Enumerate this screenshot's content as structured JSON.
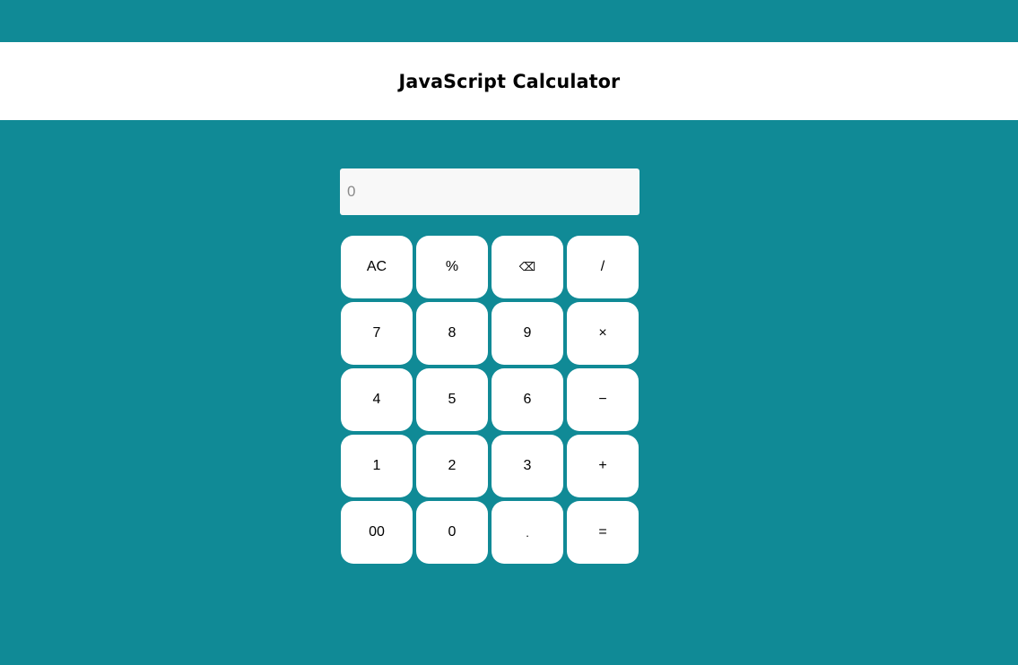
{
  "header": {
    "title": "JavaScript Calculator"
  },
  "display": {
    "value": "",
    "placeholder": "0"
  },
  "keys": [
    {
      "label": "AC"
    },
    {
      "label": "%"
    },
    {
      "label": "⌫"
    },
    {
      "label": "/"
    },
    {
      "label": "7"
    },
    {
      "label": "8"
    },
    {
      "label": "9"
    },
    {
      "label": "×"
    },
    {
      "label": "4"
    },
    {
      "label": "5"
    },
    {
      "label": "6"
    },
    {
      "label": "−"
    },
    {
      "label": "1"
    },
    {
      "label": "2"
    },
    {
      "label": "3"
    },
    {
      "label": "+"
    },
    {
      "label": "00"
    },
    {
      "label": "0"
    },
    {
      "label": "."
    },
    {
      "label": "="
    }
  ],
  "colors": {
    "background": "#108a96",
    "header": "#ffffff",
    "key": "#ffffff",
    "display": "#f8f8f8"
  }
}
